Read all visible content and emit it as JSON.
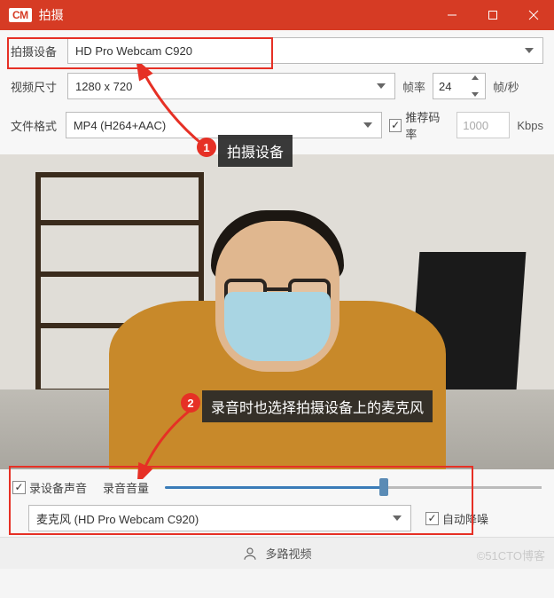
{
  "titlebar": {
    "logo": "CM",
    "title": "拍摄"
  },
  "settings": {
    "device_label": "拍摄设备",
    "device_value": "HD Pro Webcam C920",
    "size_label": "视频尺寸",
    "size_value": "1280 x 720",
    "fps_label": "帧率",
    "fps_value": "24",
    "fps_unit": "帧/秒",
    "format_label": "文件格式",
    "format_value": "MP4 (H264+AAC)",
    "rec_rate_chk": "推荐码率",
    "rate_value": "1000",
    "rate_unit": "Kbps"
  },
  "annotations": {
    "badge1": "1",
    "callout1": "拍摄设备",
    "badge2": "2",
    "callout2": "录音时也选择拍摄设备上的麦克风"
  },
  "audio": {
    "record_device_sound": "录设备声音",
    "volume_label": "录音音量",
    "mic_value": "麦克风 (HD Pro Webcam C920)",
    "auto_denoise": "自动降噪"
  },
  "footer": {
    "multi_video": "多路视频"
  },
  "watermark": "©51CTO博客"
}
